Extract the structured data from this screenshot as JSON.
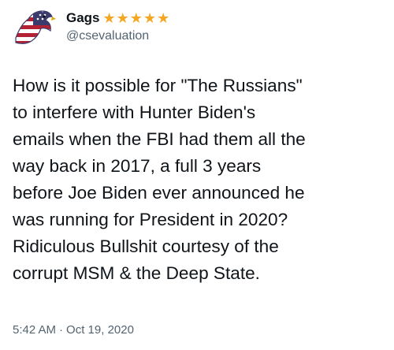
{
  "tweet": {
    "author": {
      "display_name": "Gags",
      "badge": "★★★★★",
      "handle": "@csevaluation",
      "avatar_icon": "eagle-flag-icon"
    },
    "text": "How is it possible for \"The Russians\"\nto interfere with Hunter Biden's\nemails when the FBI had them all the\nway back in 2017, a full 3 years\nbefore Joe Biden ever announced he\nwas running for President in 2020?\nRidiculous Bullshit courtesy of the\ncorrupt MSM & the Deep State.",
    "time": "5:42 AM",
    "separator": "·",
    "date": "Oct 19, 2020"
  },
  "colors": {
    "text": "#0f1419",
    "secondary": "#536471",
    "stars": "#f5a623",
    "flag_red": "#b22234",
    "flag_blue": "#3c3b6e"
  }
}
